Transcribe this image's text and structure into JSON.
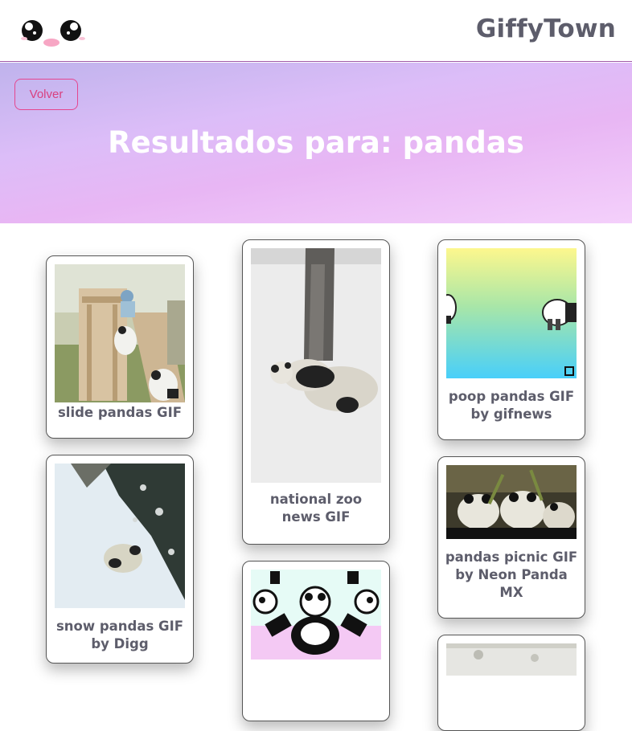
{
  "header": {
    "brand": "GiffyTown",
    "logo_icon": "kawaii-face-icon"
  },
  "hero": {
    "back_label": "Volver",
    "title": "Resultados para: pandas"
  },
  "colors": {
    "accent": "#e5468f",
    "brand_text": "#5d5d6b",
    "hero_start": "#bfb3ec",
    "hero_end": "#f4d0fb"
  },
  "results": [
    {
      "caption": "slide pandas GIF"
    },
    {
      "caption": "snow pandas GIF by Digg"
    },
    {
      "caption": "national zoo news GIF"
    },
    {
      "caption": ""
    },
    {
      "caption": "poop pandas GIF by gifnews"
    },
    {
      "caption": "pandas picnic GIF by Neon Panda MX"
    },
    {
      "caption": ""
    }
  ]
}
